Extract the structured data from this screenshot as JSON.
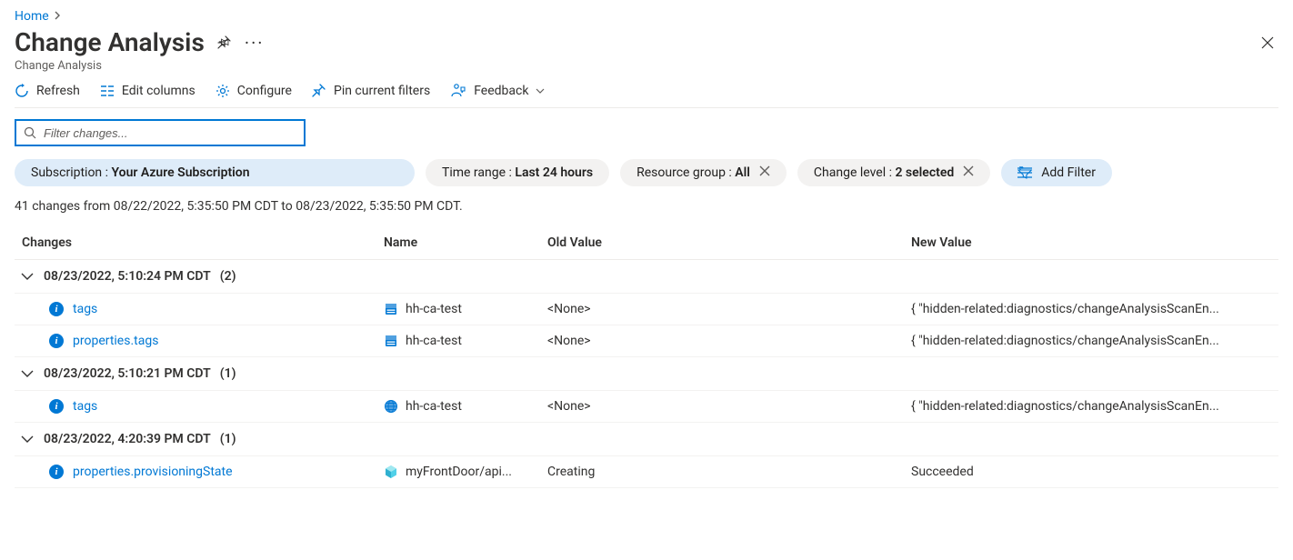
{
  "breadcrumb": {
    "home": "Home"
  },
  "header": {
    "title": "Change Analysis",
    "subtitle": "Change Analysis"
  },
  "toolbar": {
    "refresh": "Refresh",
    "edit_columns": "Edit columns",
    "configure": "Configure",
    "pin_filters": "Pin current filters",
    "feedback": "Feedback"
  },
  "filter": {
    "placeholder": "Filter changes..."
  },
  "pills": {
    "subscription_label": "Subscription : ",
    "subscription_value": "Your Azure Subscription",
    "time_label": "Time range : ",
    "time_value": "Last 24 hours",
    "rg_label": "Resource group : ",
    "rg_value": "All",
    "level_label": "Change level : ",
    "level_value": "2 selected",
    "add_filter": "Add Filter"
  },
  "summary": "41 changes from 08/22/2022, 5:35:50 PM CDT to 08/23/2022, 5:35:50 PM CDT.",
  "columns": {
    "changes": "Changes",
    "name": "Name",
    "old": "Old Value",
    "new": "New Value"
  },
  "groups": [
    {
      "timestamp": "08/23/2022, 5:10:24 PM CDT",
      "count": "(2)",
      "rows": [
        {
          "change": "tags",
          "resource": "hh-ca-test",
          "icon": "storage",
          "old": "<None>",
          "new": "{ \"hidden-related:diagnostics/changeAnalysisScanEn..."
        },
        {
          "change": "properties.tags",
          "resource": "hh-ca-test",
          "icon": "storage",
          "old": "<None>",
          "new": "{ \"hidden-related:diagnostics/changeAnalysisScanEn..."
        }
      ]
    },
    {
      "timestamp": "08/23/2022, 5:10:21 PM CDT",
      "count": "(1)",
      "rows": [
        {
          "change": "tags",
          "resource": "hh-ca-test",
          "icon": "globe",
          "old": "<None>",
          "new": "{ \"hidden-related:diagnostics/changeAnalysisScanEn..."
        }
      ]
    },
    {
      "timestamp": "08/23/2022, 4:20:39 PM CDT",
      "count": "(1)",
      "rows": [
        {
          "change": "properties.provisioningState",
          "resource": "myFrontDoor/api...",
          "icon": "cube",
          "old": "Creating",
          "new": "Succeeded"
        }
      ]
    }
  ]
}
